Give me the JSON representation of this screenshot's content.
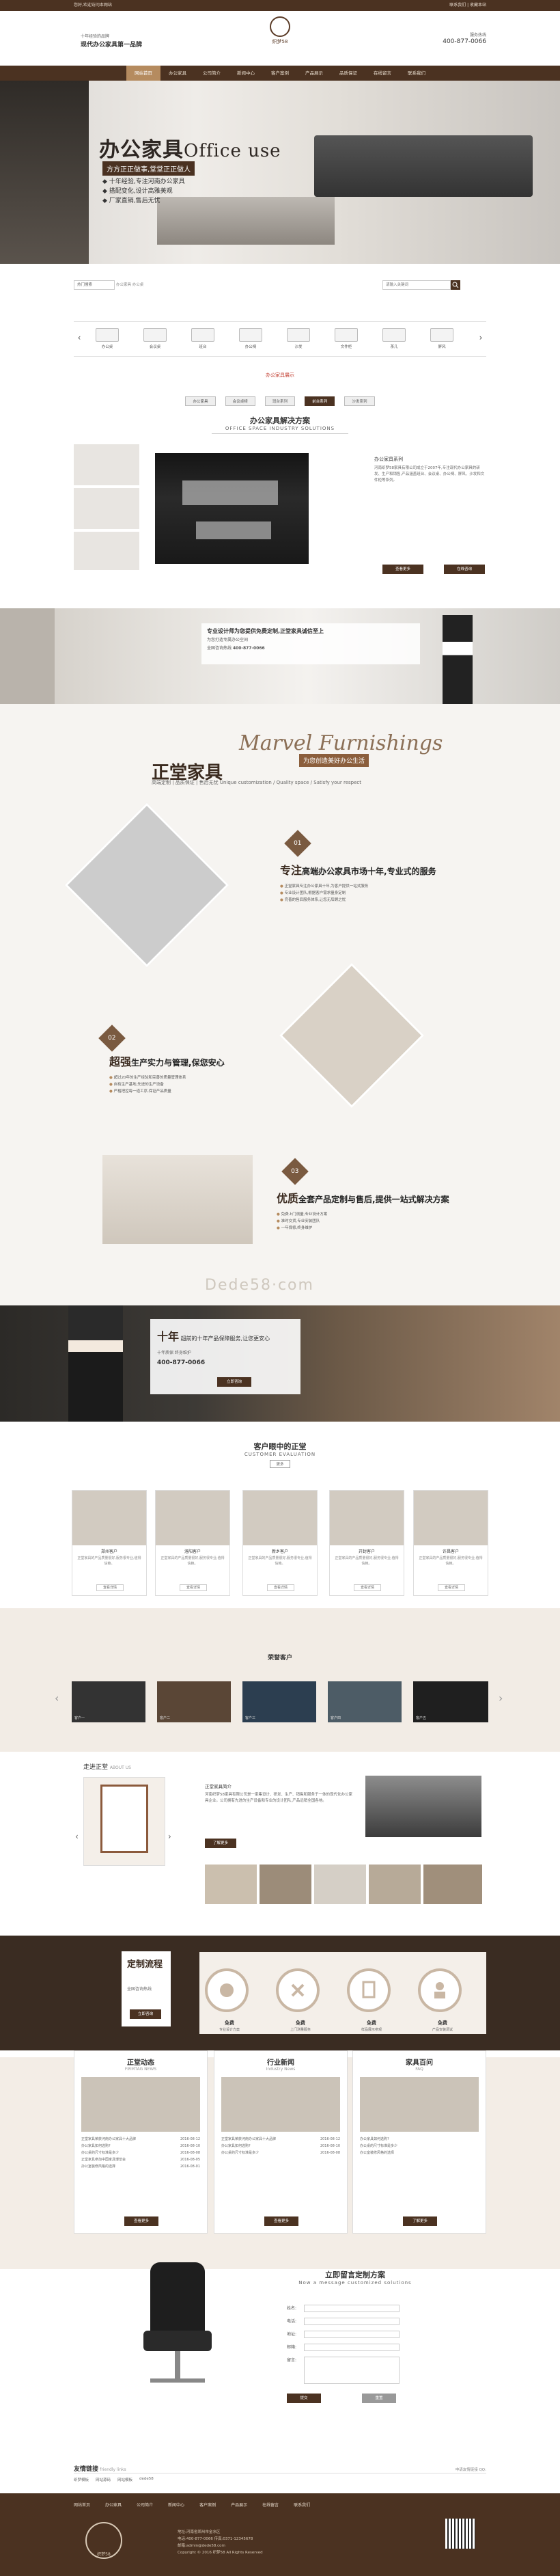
{
  "topbar": {
    "left": "您好,欢迎访问本网站",
    "right": "联系我们 | 收藏本站"
  },
  "header": {
    "slogan_small": "十年经验的品牌",
    "slogan_main": "现代办公家具第一品牌",
    "logo_text": "织梦58",
    "tel_label": "服务热线",
    "tel": "400-877-0066"
  },
  "nav": {
    "items": [
      "网站首页",
      "办公家具",
      "公司简介",
      "新闻中心",
      "客户案例",
      "产品展示",
      "品质保证",
      "在线留言",
      "联系我们"
    ]
  },
  "banner": {
    "title": "办公家具",
    "title_en": "Office use",
    "sub": "方方正正做事,堂堂正正做人",
    "points": [
      "十年经验,专注河南办公家具",
      "搭配变化,设计高雅美观",
      "厂家直销,售后无忧"
    ]
  },
  "search": {
    "select": "热门搜索",
    "hot": "办公家具 办公桌",
    "placeholder": "请输入关键词"
  },
  "cats": [
    {
      "label": "办公桌"
    },
    {
      "label": "会议桌"
    },
    {
      "label": "班台"
    },
    {
      "label": "办公椅"
    },
    {
      "label": "沙发"
    },
    {
      "label": "文件柜"
    },
    {
      "label": "茶几"
    },
    {
      "label": "屏风"
    }
  ],
  "products_heading": "办公家具展示",
  "product_tabs": [
    "办公家具",
    "会议桌椅",
    "班台系列",
    "前台系列",
    "沙发系列"
  ],
  "plan": {
    "zh": "办公家具解决方案",
    "en": "OFFICE SPACE INDUSTRY SOLUTIONS",
    "label": "办公家具系列",
    "text": "河南织梦58家具有限公司成立于2007年,专注现代办公家具的研发、生产和销售,产品涵盖班台、会议桌、办公椅、屏风、沙发和文件柜等系列。",
    "btn1": "查看更多",
    "btn2": "在线咨询"
  },
  "strip": {
    "t1": "专业设计师为您提供免费定制,正堂家具诚信至上",
    "t2": "为您打造专属办公空间",
    "t3": "全国咨询热线",
    "tel": "400-877-0066"
  },
  "zhengtang": {
    "title": "正堂家具",
    "en": "Marvel Furnishings",
    "badge": "为您创造美好办公生活",
    "sub": "高端定制 | 品质保证 | 售后无忧  Unique customization / Quality space / Satisfy your respect",
    "f1": {
      "num": "01",
      "big": "专注",
      "title": "高端办公家具市场十年,专业式的服务",
      "items": [
        "正堂家具专注办公家具十年,为客户提供一站式服务",
        "专业设计团队,根据客户需求量身定制",
        "完善的售后服务体系,让您无后顾之忧"
      ]
    },
    "f2": {
      "num": "02",
      "big": "超强",
      "title": "生产实力与管理,保您安心",
      "items": [
        "超过20年的生产经验和完善的质量管理体系",
        "自有生产基地,先进的生产设备",
        "严格把控每一道工序,保证产品质量"
      ]
    },
    "f3": {
      "num": "03",
      "big": "优质",
      "title": "全套产品定制与售后,提供一站式解决方案",
      "items": [
        "免费上门测量,专业设计方案",
        "准时交货,专业安装团队",
        "一年保修,终身维护"
      ]
    }
  },
  "banner2": {
    "big": "十年",
    "title": "超前的十年产品保障服务,让您更安心",
    "sub": "十年质保 终身维护",
    "tel": "400-877-0066",
    "btn": "立即咨询"
  },
  "watermark": "Dede58·com",
  "customer": {
    "zh": "客户眼中的正堂",
    "en": "CUSTOMER EVALUATION",
    "tag": "更多",
    "cards": [
      {
        "name": "郑州客户",
        "desc": "正堂家具的产品质量很好,服务很专业,值得信赖。",
        "btn": "查看详情"
      },
      {
        "name": "洛阳客户",
        "desc": "正堂家具的产品质量很好,服务很专业,值得信赖。",
        "btn": "查看详情"
      },
      {
        "name": "新乡客户",
        "desc": "正堂家具的产品质量很好,服务很专业,值得信赖。",
        "btn": "查看详情"
      },
      {
        "name": "开封客户",
        "desc": "正堂家具的产品质量很好,服务很专业,值得信赖。",
        "btn": "查看详情"
      },
      {
        "name": "许昌客户",
        "desc": "正堂家具的产品质量很好,服务很专业,值得信赖。",
        "btn": "查看详情"
      }
    ]
  },
  "partners": {
    "title": "荣誉客户",
    "items": [
      "客户一",
      "客户二",
      "客户三",
      "客户四",
      "客户五",
      "客户六"
    ]
  },
  "about": {
    "title": "走进正堂",
    "sub": "ABOUT US",
    "name": "正堂家具简介",
    "text": "河南织梦58家具有限公司是一家集设计、研发、生产、销售和服务于一体的现代化办公家具企业。公司拥有先进的生产设备和专业的设计团队,产品远销全国各地。",
    "btn": "了解更多"
  },
  "custom": {
    "title": "定制流程",
    "sub": "全国咨询热线",
    "btn": "立即咨询",
    "steps": [
      {
        "t": "免费",
        "d": "专业设计方案"
      },
      {
        "t": "免费",
        "d": "上门测量服务"
      },
      {
        "t": "免费",
        "d": "样品展示参观"
      },
      {
        "t": "免费",
        "d": "产品安装调试"
      }
    ]
  },
  "news": {
    "cols": [
      {
        "z": "正堂动态",
        "e": "FIRMTAG NEWS",
        "btn": "查看更多"
      },
      {
        "z": "行业新闻",
        "e": "Industry News",
        "btn": "查看更多"
      },
      {
        "z": "家具百问",
        "e": "FAQ",
        "btn": "了解更多"
      }
    ],
    "items": [
      "正堂家具荣获河南办公家具十大品牌",
      "办公家具如何选购?",
      "办公桌的尺寸标准是多少",
      "正堂家具参加中国家具博览会",
      "办公室装修风格的选择"
    ],
    "dates": [
      "2016-08-12",
      "2016-08-10",
      "2016-08-08",
      "2016-08-05",
      "2016-08-01"
    ]
  },
  "message": {
    "zh": "立即留言定制方案",
    "en": "Now a message customized solutions",
    "fields": [
      "姓名:",
      "电话:",
      "地址:",
      "邮箱:",
      "留言:"
    ],
    "btn1": "提交",
    "btn2": "重置"
  },
  "links": {
    "title": "友情链接",
    "en": "friendly links",
    "items": [
      "织梦模板",
      "网站源码",
      "网站模板",
      "dede58"
    ],
    "right": "申请友情链接 QQ:"
  },
  "footer": {
    "nav": [
      "网站首页",
      "办公家具",
      "公司简介",
      "新闻中心",
      "客户案例",
      "产品展示",
      "在线留言",
      "联系我们"
    ],
    "lines": [
      "地址:河南省郑州市金水区",
      "电话:400-877-0066  传真:0371-12345678",
      "邮箱:admin@dede58.com",
      "Copyright © 2016 织梦58 All Rights Reserved"
    ],
    "logo": "织梦58"
  }
}
